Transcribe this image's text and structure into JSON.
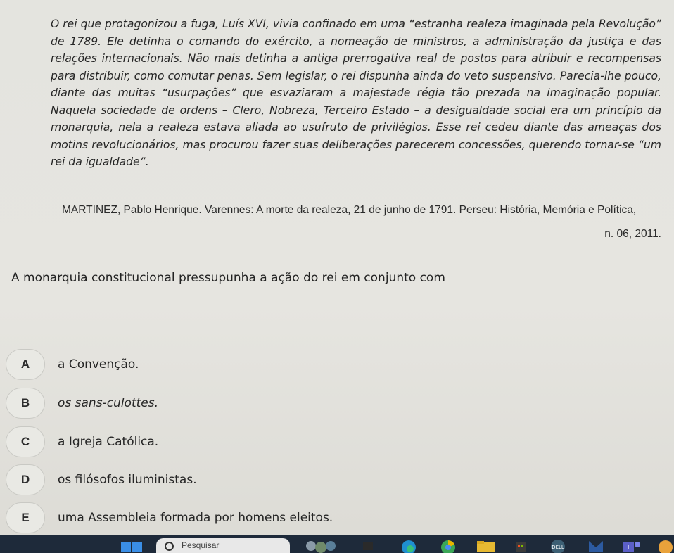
{
  "passage": "O rei que protagonizou a fuga, Luís XVI, vivia confinado em uma “estranha realeza imaginada pela Revolução” de 1789. Ele detinha o comando do exército, a nomeação de ministros, a administração da justiça e das relações internacionais. Não mais detinha a antiga prerrogativa real de postos para atribuir e recompensas para distribuir, como comutar penas. Sem legislar, o rei dispunha ainda do veto suspensivo. Parecia-lhe pouco, diante das muitas “usurpações” que esvaziaram a majestade régia tão prezada na imaginação popular. Naquela sociedade de ordens – Clero, Nobreza, Terceiro Estado – a desigualdade social era um princípio da monarquia, nela a realeza estava aliada ao usufruto de privilégios. Esse rei cedeu diante das ameaças dos motins revolucionários, mas procurou fazer suas deliberações parecerem concessões, querendo tornar-se “um rei da igualdade”.",
  "citation": {
    "line1": "MARTINEZ, Pablo Henrique. Varennes: A morte da realeza, 21 de junho de 1791. Perseu: História, Memória e Política,",
    "line2": "n. 06, 2011."
  },
  "question": "A monarquia constitucional pressupunha a ação do rei em conjunto com",
  "options": [
    {
      "letter": "A",
      "text": "a Convenção."
    },
    {
      "letter": "B",
      "text": "os sans-culottes."
    },
    {
      "letter": "C",
      "text": "a Igreja Católica."
    },
    {
      "letter": "D",
      "text": "os filósofos iluministas."
    },
    {
      "letter": "E",
      "text": "uma Assembleia formada por homens eleitos."
    }
  ],
  "taskbar": {
    "search_label": "Pesquisar",
    "icons": [
      "windows-start-icon",
      "search-icon",
      "widgets-icon",
      "file-explorer-icon",
      "edge-icon",
      "chrome-icon",
      "folder-icon",
      "store-icon",
      "dell-icon",
      "mail-icon",
      "teams-icon",
      "app-icon"
    ]
  }
}
